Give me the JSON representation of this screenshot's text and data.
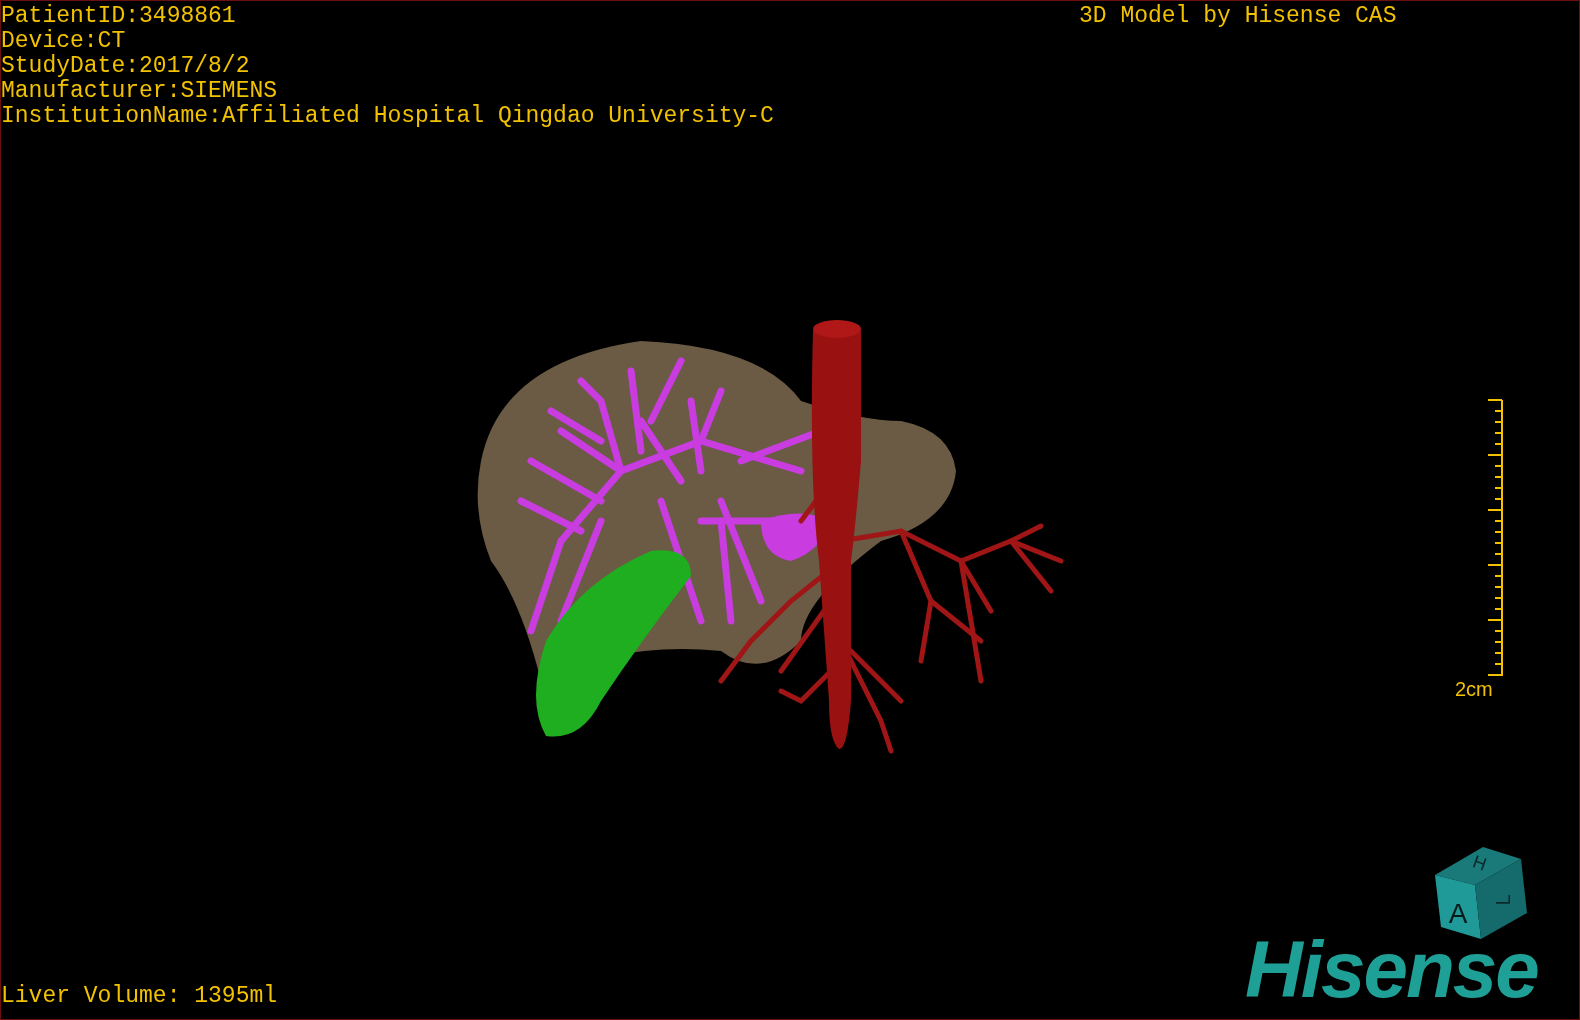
{
  "study_info": [
    "PatientID:3498861",
    "Device:CT",
    "StudyDate:2017/8/2",
    "Manufacturer:SIEMENS",
    "InstitutionName:Affiliated Hospital Qingdao University-C"
  ],
  "title": "3D Model by Hisense CAS",
  "scale_bar": {
    "label": "2cm"
  },
  "orientation_cube": {
    "top": "H",
    "front": "A",
    "side": "L"
  },
  "liver_volume": "Liver Volume: 1395ml",
  "logo": "Hisense"
}
